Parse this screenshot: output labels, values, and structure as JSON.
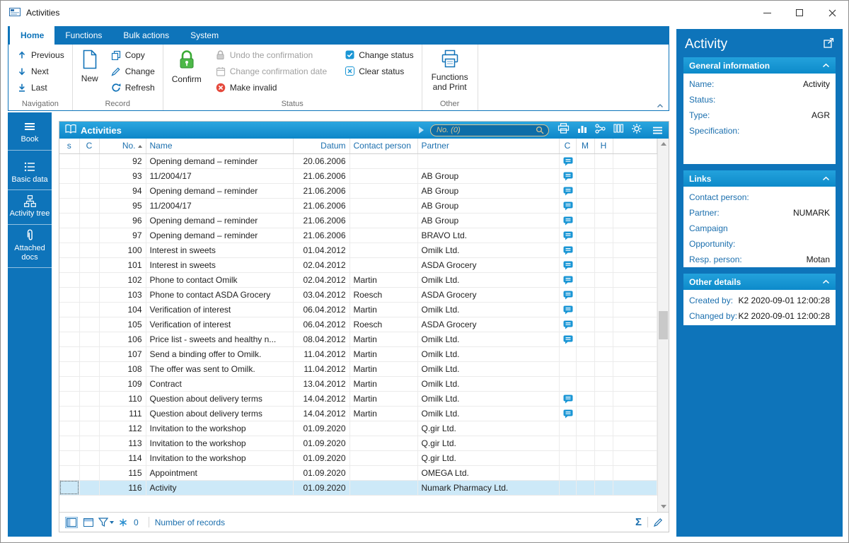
{
  "window": {
    "title": "Activities"
  },
  "tabs": [
    "Home",
    "Functions",
    "Bulk actions",
    "System"
  ],
  "ribbon": {
    "navigation": {
      "label": "Navigation",
      "previous": "Previous",
      "next": "Next",
      "last": "Last"
    },
    "record": {
      "label": "Record",
      "new": "New",
      "copy": "Copy",
      "change": "Change",
      "refresh": "Refresh"
    },
    "status": {
      "label": "Status",
      "confirm": "Confirm",
      "undo": "Undo the confirmation",
      "change_date": "Change confirmation date",
      "make_invalid": "Make invalid",
      "change_status": "Change status",
      "clear_status": "Clear status"
    },
    "other": {
      "label": "Other",
      "functions_print": "Functions and Print"
    }
  },
  "sidebar": {
    "items": [
      {
        "label": "Book"
      },
      {
        "label": "Basic data"
      },
      {
        "label": "Activity tree"
      },
      {
        "label": "Attached docs"
      }
    ]
  },
  "list": {
    "title": "Activities",
    "search_placeholder": "No. (0)",
    "columns": [
      "s",
      "C",
      "No.",
      "Name",
      "Datum",
      "Contact person",
      "Partner",
      "C",
      "M",
      "H"
    ],
    "rows": [
      {
        "no": "92",
        "name": "Opening demand – reminder",
        "date": "20.06.2006",
        "contact": "",
        "partner": "",
        "comment": true,
        "selected": false
      },
      {
        "no": "93",
        "name": "11/2004/17",
        "date": "21.06.2006",
        "contact": "",
        "partner": "AB Group",
        "comment": true,
        "selected": false
      },
      {
        "no": "94",
        "name": "Opening demand – reminder",
        "date": "21.06.2006",
        "contact": "",
        "partner": "AB Group",
        "comment": true,
        "selected": false
      },
      {
        "no": "95",
        "name": "11/2004/17",
        "date": "21.06.2006",
        "contact": "",
        "partner": "AB Group",
        "comment": true,
        "selected": false
      },
      {
        "no": "96",
        "name": "Opening demand – reminder",
        "date": "21.06.2006",
        "contact": "",
        "partner": "AB Group",
        "comment": true,
        "selected": false
      },
      {
        "no": "97",
        "name": "Opening demand – reminder",
        "date": "21.06.2006",
        "contact": "",
        "partner": "BRAVO Ltd.",
        "comment": true,
        "selected": false
      },
      {
        "no": "100",
        "name": "Interest in sweets",
        "date": "01.04.2012",
        "contact": "",
        "partner": "Omilk Ltd.",
        "comment": true,
        "selected": false
      },
      {
        "no": "101",
        "name": "Interest in sweets",
        "date": "02.04.2012",
        "contact": "",
        "partner": "ASDA Grocery",
        "comment": true,
        "selected": false
      },
      {
        "no": "102",
        "name": "Phone to contact Omilk",
        "date": "02.04.2012",
        "contact": "Martin",
        "partner": "Omilk Ltd.",
        "comment": true,
        "selected": false
      },
      {
        "no": "103",
        "name": "Phone to contact ASDA Grocery",
        "date": "03.04.2012",
        "contact": "Roesch",
        "partner": "ASDA Grocery",
        "comment": true,
        "selected": false
      },
      {
        "no": "104",
        "name": "Verification of interest",
        "date": "06.04.2012",
        "contact": "Martin",
        "partner": "Omilk Ltd.",
        "comment": true,
        "selected": false
      },
      {
        "no": "105",
        "name": "Verification of interest",
        "date": "06.04.2012",
        "contact": "Roesch",
        "partner": "ASDA Grocery",
        "comment": true,
        "selected": false
      },
      {
        "no": "106",
        "name": "Price list - sweets and healthy n...",
        "date": "08.04.2012",
        "contact": "Martin",
        "partner": "Omilk Ltd.",
        "comment": true,
        "selected": false
      },
      {
        "no": "107",
        "name": "Send a binding offer to Omilk.",
        "date": "11.04.2012",
        "contact": "Martin",
        "partner": "Omilk Ltd.",
        "comment": false,
        "selected": false
      },
      {
        "no": "108",
        "name": "The offer was sent to Omilk.",
        "date": "11.04.2012",
        "contact": "Martin",
        "partner": "Omilk Ltd.",
        "comment": false,
        "selected": false
      },
      {
        "no": "109",
        "name": "Contract",
        "date": "13.04.2012",
        "contact": "Martin",
        "partner": "Omilk Ltd.",
        "comment": false,
        "selected": false
      },
      {
        "no": "110",
        "name": "Question about delivery terms",
        "date": "14.04.2012",
        "contact": "Martin",
        "partner": "Omilk Ltd.",
        "comment": true,
        "selected": false
      },
      {
        "no": "111",
        "name": "Question about delivery terms",
        "date": "14.04.2012",
        "contact": "Martin",
        "partner": "Omilk Ltd.",
        "comment": true,
        "selected": false
      },
      {
        "no": "112",
        "name": "Invitation to the workshop",
        "date": "01.09.2020",
        "contact": "",
        "partner": "Q.gir Ltd.",
        "comment": false,
        "selected": false
      },
      {
        "no": "113",
        "name": "Invitation to the workshop",
        "date": "01.09.2020",
        "contact": "",
        "partner": "Q.gir Ltd.",
        "comment": false,
        "selected": false
      },
      {
        "no": "114",
        "name": "Invitation to the workshop",
        "date": "01.09.2020",
        "contact": "",
        "partner": "Q.gir Ltd.",
        "comment": false,
        "selected": false
      },
      {
        "no": "115",
        "name": "Appointment",
        "date": "01.09.2020",
        "contact": "",
        "partner": "OMEGA Ltd.",
        "comment": false,
        "selected": false
      },
      {
        "no": "116",
        "name": "Activity",
        "date": "01.09.2020",
        "contact": "",
        "partner": "Numark Pharmacy Ltd.",
        "comment": false,
        "selected": true
      }
    ],
    "footer": {
      "marked_count": "0",
      "records_label": "Number of records"
    }
  },
  "detail": {
    "title": "Activity",
    "general": {
      "header": "General information",
      "fields": [
        {
          "label": "Name:",
          "value": "Activity"
        },
        {
          "label": "Status:",
          "value": ""
        },
        {
          "label": "Type:",
          "value": "AGR"
        },
        {
          "label": "Specification:",
          "value": ""
        }
      ]
    },
    "links": {
      "header": "Links",
      "fields": [
        {
          "label": "Contact person:",
          "value": ""
        },
        {
          "label": "Partner:",
          "value": "NUMARK"
        },
        {
          "label": "Campaign",
          "value": ""
        },
        {
          "label": "Opportunity:",
          "value": ""
        },
        {
          "label": "Resp. person:",
          "value": "Motan"
        }
      ]
    },
    "other_details": {
      "header": "Other details",
      "fields": [
        {
          "label": "Created by:",
          "value": "K2 2020-09-01 12:00:28"
        },
        {
          "label": "Changed by:",
          "value": "K2 2020-09-01 12:00:28"
        }
      ]
    }
  },
  "icons": {
    "sigma": "Σ"
  }
}
